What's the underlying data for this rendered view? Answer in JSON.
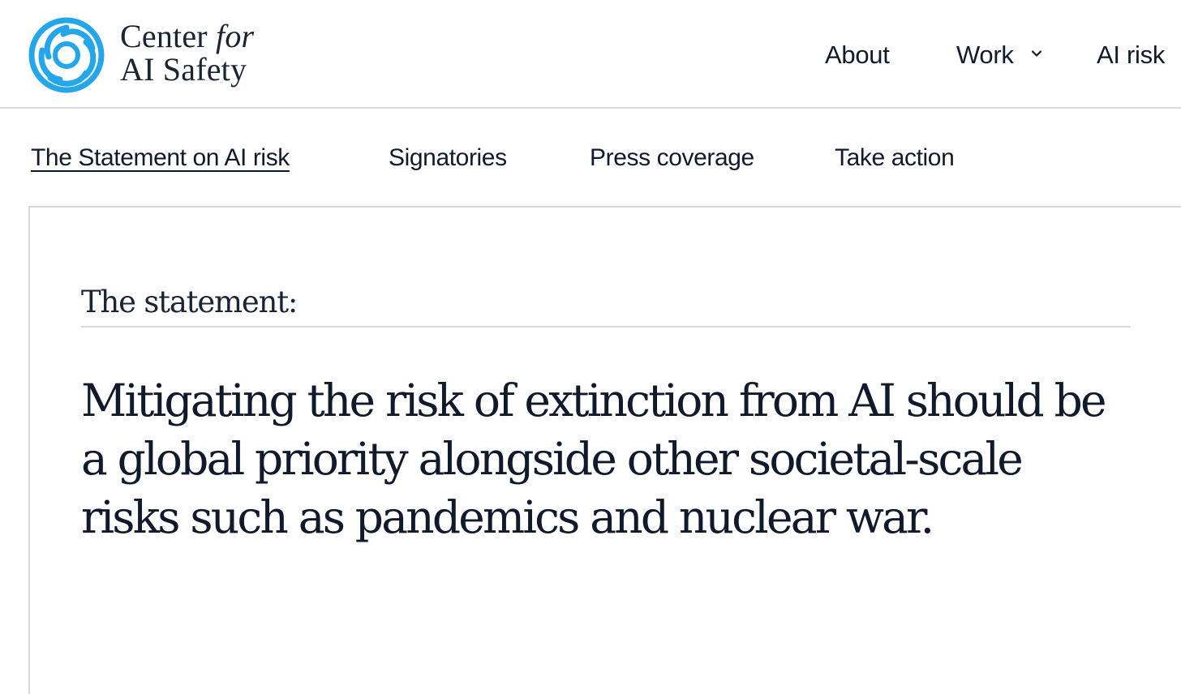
{
  "brand": {
    "line1_word": "Center",
    "line1_italic": "for",
    "line2": "AI Safety",
    "logo_icon": "cais-spiral-logo-icon",
    "logo_color": "#23a6ea"
  },
  "top_nav": {
    "about": "About",
    "work": "Work",
    "work_icon": "chevron-down-icon",
    "ai_risk": "AI risk"
  },
  "sub_nav": {
    "statement": "The Statement on AI risk",
    "signatories": "Signatories",
    "press_coverage": "Press coverage",
    "take_action": "Take action",
    "active": "statement"
  },
  "main": {
    "label": "The statement:",
    "statement_lines": [
      "Mitigating the risk of extinction from AI should be",
      "a global priority alongside other societal-scale",
      "risks such as pandemics and nuclear war."
    ]
  },
  "colors": {
    "text": "#101a2a",
    "border": "#d4d7dc",
    "accent": "#23a6ea"
  }
}
